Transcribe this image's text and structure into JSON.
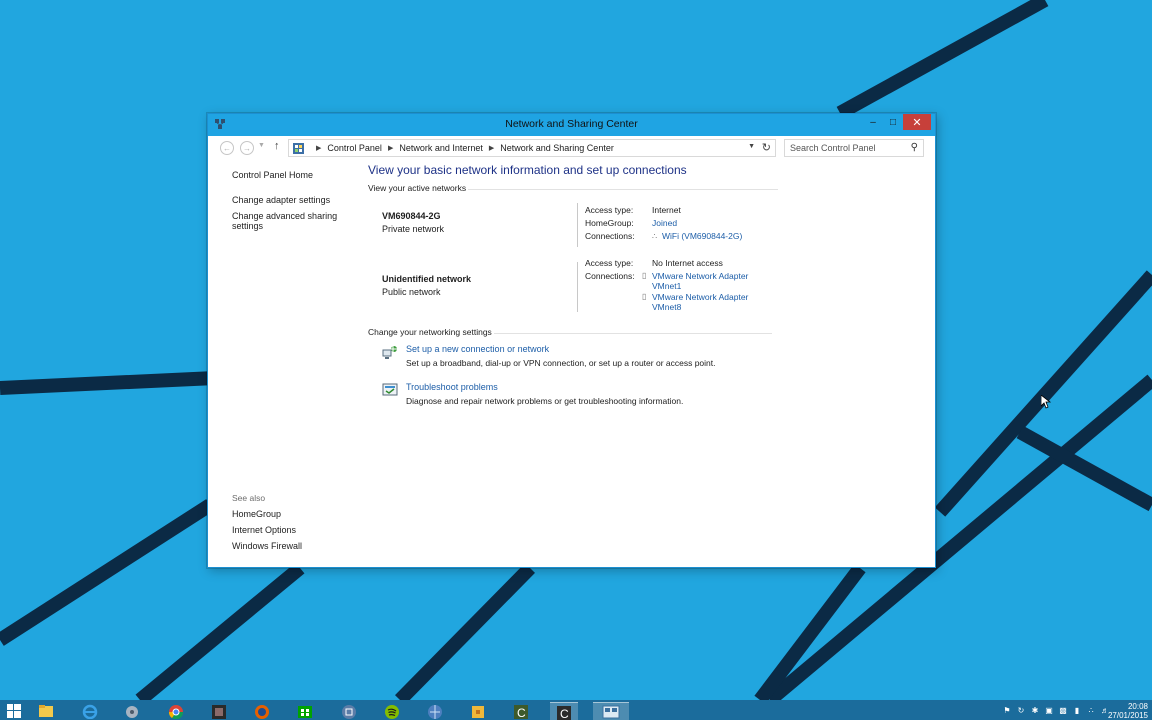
{
  "window": {
    "title": "Network and Sharing Center"
  },
  "address": {
    "crumbs": [
      "Control Panel",
      "Network and Internet",
      "Network and Sharing Center"
    ],
    "search_placeholder": "Search Control Panel"
  },
  "left_pane": {
    "home": "Control Panel Home",
    "links": [
      "Change adapter settings",
      "Change advanced sharing settings"
    ],
    "see_also_heading": "See also",
    "see_also": [
      "HomeGroup",
      "Internet Options",
      "Windows Firewall"
    ]
  },
  "main": {
    "heading": "View your basic network information and set up connections",
    "active_heading": "View your active networks",
    "networks": [
      {
        "name": "VM690844-2G",
        "type": "Private network",
        "access_type_label": "Access type:",
        "access_type": "Internet",
        "homegroup_label": "HomeGroup:",
        "homegroup": "Joined",
        "connections_label": "Connections:",
        "connection": "WiFi (VM690844-2G)"
      },
      {
        "name": "Unidentified network",
        "type": "Public network",
        "access_type_label": "Access type:",
        "access_type": "No Internet access",
        "connections_label": "Connections:",
        "adapters": [
          "VMware Network Adapter VMnet1",
          "VMware Network Adapter VMnet8"
        ]
      }
    ],
    "change_heading": "Change your networking settings",
    "tasks": [
      {
        "link": "Set up a new connection or network",
        "desc": "Set up a broadband, dial-up or VPN connection, or set up a router or access point."
      },
      {
        "link": "Troubleshoot problems",
        "desc": "Diagnose and repair network problems or get troubleshooting information."
      }
    ]
  },
  "taskbar": {
    "apps": [
      "start",
      "file-explorer",
      "internet-explorer",
      "media",
      "chrome",
      "game",
      "firefox",
      "store",
      "vmware",
      "spotify",
      "globe",
      "puzzle",
      "camtasia-recorder",
      "camtasia-studio",
      "control-panel"
    ],
    "clock_time": "20:08",
    "clock_date": "27/01/2015"
  },
  "colors": {
    "desktop": "#21a6df",
    "titlebar": "#1fa4e3",
    "close_button": "#c7403a",
    "link": "#1d5ea8",
    "heading": "#1e3287",
    "taskbar": "#1b6c9c"
  }
}
